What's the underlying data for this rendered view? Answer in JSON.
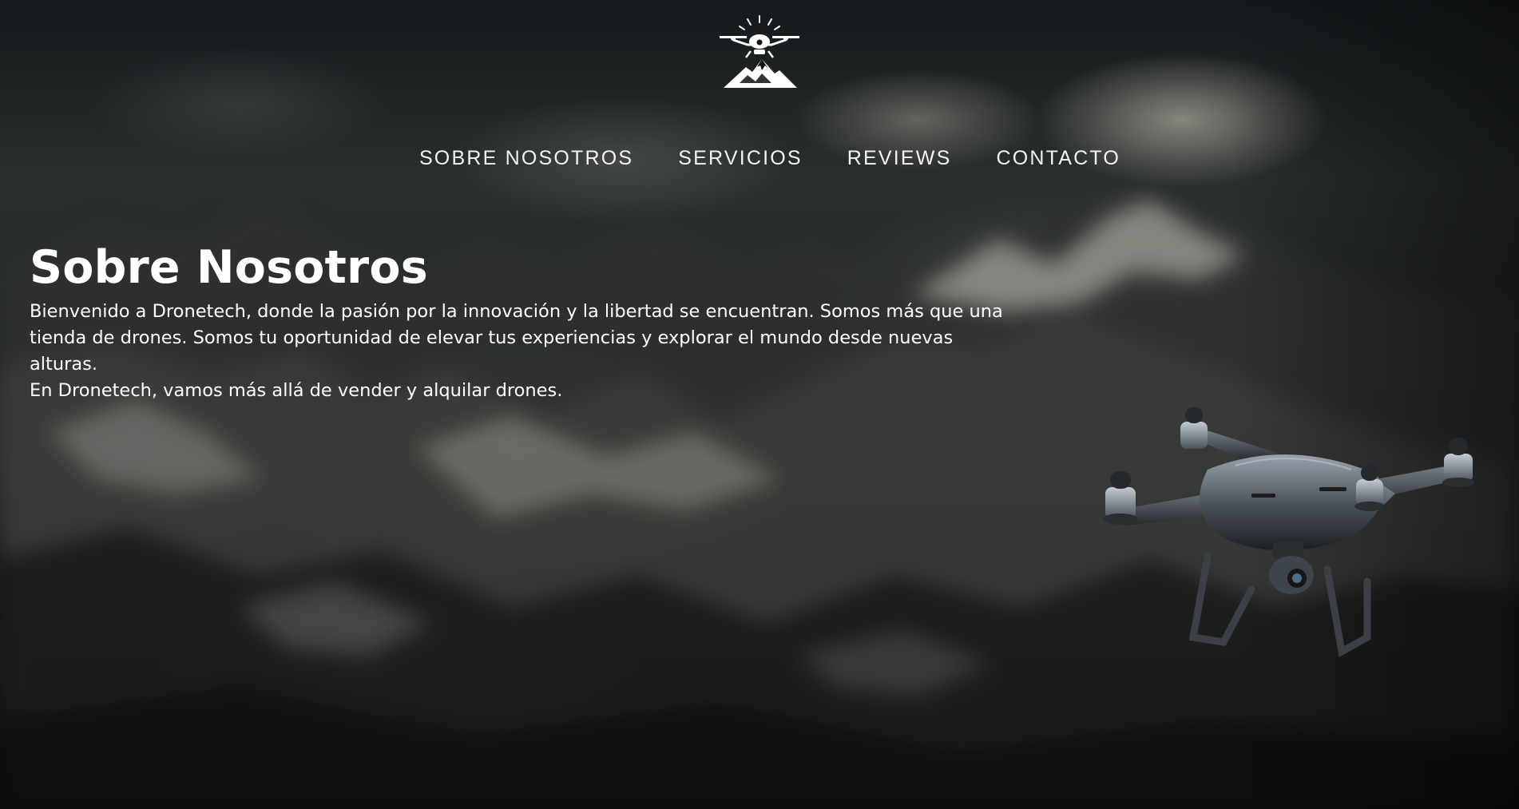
{
  "brand": {
    "logo_icon": "drone-mountain-logo-icon"
  },
  "nav": {
    "items": [
      {
        "label": "SOBRE NOSOTROS"
      },
      {
        "label": "SERVICIOS"
      },
      {
        "label": "REVIEWS"
      },
      {
        "label": "CONTACTO"
      }
    ]
  },
  "hero": {
    "title": "Sobre Nosotros",
    "lines": [
      "Bienvenido a Dronetech, donde la pasión por la innovación y la libertad se encuentran. Somos más que una",
      "tienda de drones. Somos tu oportunidad de elevar tus experiencias y explorar el mundo desde nuevas alturas.",
      "En Dronetech, vamos más allá de vender y alquilar drones."
    ]
  },
  "images": {
    "background": "blurred-dark-mountains",
    "drone": "quadcopter-drone-image"
  },
  "colors": {
    "text": "#ffffff",
    "background": "#1c1f1f"
  }
}
